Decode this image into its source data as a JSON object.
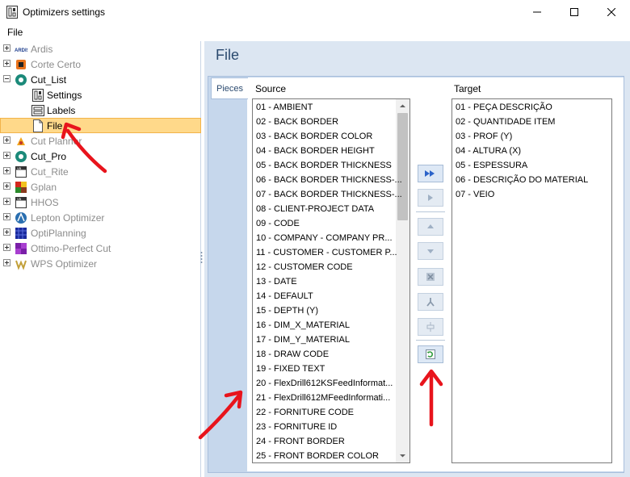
{
  "window": {
    "title": "Optimizers settings"
  },
  "menu": {
    "file": "File"
  },
  "tree": {
    "items": [
      {
        "label": "Ardis",
        "enabled": false,
        "icon": "ardis-logo-icon"
      },
      {
        "label": "Corte Certo",
        "enabled": false,
        "icon": "corte-certo-icon"
      },
      {
        "label": "Cut_List",
        "enabled": true,
        "icon": "cut-list-icon",
        "expanded": true
      },
      {
        "label": "Settings",
        "enabled": true,
        "icon": "settings-icon",
        "child": true
      },
      {
        "label": "Labels",
        "enabled": true,
        "icon": "labels-icon",
        "child": true
      },
      {
        "label": "File",
        "enabled": true,
        "icon": "file-icon",
        "child": true,
        "selected": true
      },
      {
        "label": "Cut Planner",
        "enabled": false,
        "icon": "cut-planner-icon"
      },
      {
        "label": "Cut_Pro",
        "enabled": true,
        "icon": "cut-pro-icon"
      },
      {
        "label": "Cut_Rite",
        "enabled": false,
        "icon": "cut-rite-icon"
      },
      {
        "label": "Gplan",
        "enabled": false,
        "icon": "gplan-icon"
      },
      {
        "label": "HHOS",
        "enabled": false,
        "icon": "hhos-icon"
      },
      {
        "label": "Lepton Optimizer",
        "enabled": false,
        "icon": "lepton-icon"
      },
      {
        "label": "OptiPlanning",
        "enabled": false,
        "icon": "optiplanning-icon"
      },
      {
        "label": "Ottimo-Perfect Cut",
        "enabled": false,
        "icon": "ottimo-icon"
      },
      {
        "label": "WPS Optimizer",
        "enabled": false,
        "icon": "wps-icon"
      }
    ]
  },
  "panel": {
    "title": "File",
    "tab": "Pieces",
    "source_header": "Source",
    "target_header": "Target"
  },
  "source": [
    "01 - AMBIENT",
    "02 - BACK BORDER",
    "03 - BACK BORDER COLOR",
    "04 - BACK BORDER HEIGHT",
    "05 - BACK BORDER THICKNESS",
    "06 - BACK BORDER THICKNESS-...",
    "07 - BACK BORDER THICKNESS-...",
    "08 - CLIENT-PROJECT DATA",
    "09 - CODE",
    "10 - COMPANY - COMPANY PR...",
    "11 - CUSTOMER - CUSTOMER P...",
    "12 - CUSTOMER CODE",
    "13 - DATE",
    "14 - DEFAULT",
    "15 - DEPTH (Y)",
    "16 - DIM_X_MATERIAL",
    "17 - DIM_Y_MATERIAL",
    "18 - DRAW CODE",
    "19 - FIXED TEXT",
    "20 - FlexDrill612KSFeedInformat...",
    "21 - FlexDrill612MFeedInformati...",
    "22 - FORNITURE CODE",
    "23 - FORNITURE ID",
    "24 - FRONT BORDER",
    "25 - FRONT BORDER COLOR"
  ],
  "target": [
    "01 - PEÇA DESCRIÇÃO",
    "02 - QUANTIDADE ITEM",
    "03 - PROF (Y)",
    "04 - ALTURA (X)",
    "05 - ESPESSURA",
    "06 - DESCRIÇÃO DO MATERIAL",
    "07 - VEIO"
  ],
  "colors": {
    "selection": "#ffd98a",
    "panel_bg": "#dce6f2",
    "accent": "#2b4a6f",
    "annotation": "#e8141c"
  }
}
